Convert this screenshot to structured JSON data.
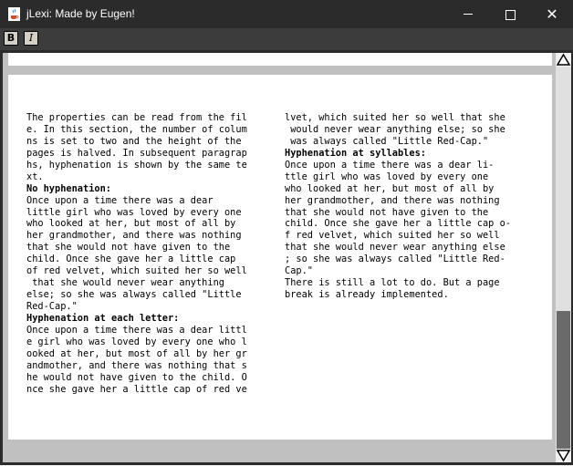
{
  "window": {
    "title": "jLexi: Made by Eugen!"
  },
  "toolbar": {
    "bold_label": "B",
    "italic_label": "I"
  },
  "document": {
    "left_column": [
      {
        "text": "The properties can be read from the fil",
        "bold": false
      },
      {
        "text": "e. In this section, the number of colum",
        "bold": false
      },
      {
        "text": "ns is set to two and the height of the",
        "bold": false
      },
      {
        "text": "pages is halved. In subsequent paragrap",
        "bold": false
      },
      {
        "text": "hs, hyphenation is shown by the same te",
        "bold": false
      },
      {
        "text": "xt.",
        "bold": false
      },
      {
        "text": "No hyphenation:",
        "bold": true
      },
      {
        "text": "Once upon a time there was a dear",
        "bold": false
      },
      {
        "text": "little girl who was loved by every one",
        "bold": false
      },
      {
        "text": "who looked at her, but most of all by",
        "bold": false
      },
      {
        "text": "her grandmother, and there was nothing",
        "bold": false
      },
      {
        "text": "that she would not have given to the",
        "bold": false
      },
      {
        "text": "child. Once she gave her a little cap",
        "bold": false
      },
      {
        "text": "of red velvet, which suited her so well",
        "bold": false
      },
      {
        "text": " that she would never wear anything",
        "bold": false
      },
      {
        "text": "else; so she was always called \"Little",
        "bold": false
      },
      {
        "text": "Red-Cap.\"",
        "bold": false
      },
      {
        "text": "Hyphenation at each letter:",
        "bold": true
      },
      {
        "text": "Once upon a time there was a dear littl",
        "bold": false
      },
      {
        "text": "e girl who was loved by every one who l",
        "bold": false
      },
      {
        "text": "ooked at her, but most of all by her gr",
        "bold": false
      },
      {
        "text": "andmother, and there was nothing that s",
        "bold": false
      },
      {
        "text": "he would not have given to the child. O",
        "bold": false
      },
      {
        "text": "nce she gave her a little cap of red ve",
        "bold": false
      }
    ],
    "right_column": [
      {
        "text": "lvet, which suited her so well that she",
        "bold": false
      },
      {
        "text": " would never wear anything else; so she",
        "bold": false
      },
      {
        "text": " was always called \"Little Red-Cap.\"",
        "bold": false
      },
      {
        "text": "Hyphenation at syllables:",
        "bold": true
      },
      {
        "text": "Once upon a time there was a dear li-",
        "bold": false
      },
      {
        "text": "ttle girl who was loved by every one",
        "bold": false
      },
      {
        "text": "who looked at her, but most of all by",
        "bold": false
      },
      {
        "text": "her grandmother, and there was nothing",
        "bold": false
      },
      {
        "text": "that she would not have given to the",
        "bold": false
      },
      {
        "text": "child. Once she gave her a little cap o-",
        "bold": false
      },
      {
        "text": "f red velvet, which suited her so well",
        "bold": false
      },
      {
        "text": "that she would never wear anything else",
        "bold": false
      },
      {
        "text": "; so she was always called \"Little Red-",
        "bold": false
      },
      {
        "text": "Cap.\"",
        "bold": false
      },
      {
        "text": "There is still a lot to do. But a page",
        "bold": false
      },
      {
        "text": "break is already implemented.",
        "bold": false
      }
    ]
  },
  "scrollbar": {
    "position_fraction": 0.68
  }
}
